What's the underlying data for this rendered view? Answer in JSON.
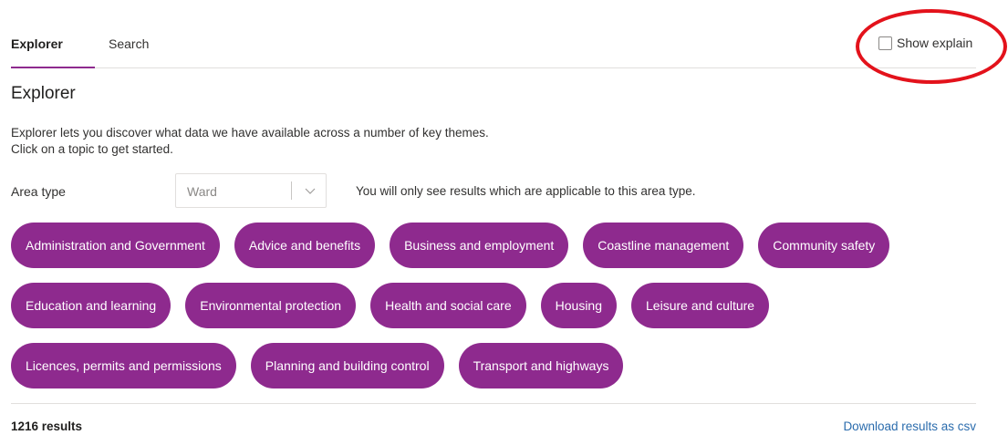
{
  "tabs": [
    {
      "label": "Explorer",
      "active": true
    },
    {
      "label": "Search",
      "active": false
    }
  ],
  "show_explain": {
    "label": "Show explain",
    "checked": false
  },
  "page_title": "Explorer",
  "intro": {
    "line1": "Explorer lets you discover what data we have available across a number of key themes.",
    "line2": "Click on a topic to get started."
  },
  "area_type": {
    "label": "Area type",
    "value": "Ward",
    "hint": "You will only see results which are applicable to this area type."
  },
  "topics": [
    "Administration and Government",
    "Advice and benefits",
    "Business and employment",
    "Coastline management",
    "Community safety",
    "Education and learning",
    "Environmental protection",
    "Health and social care",
    "Housing",
    "Leisure and culture",
    "Licences, permits and permissions",
    "Planning and building control",
    "Transport and highways"
  ],
  "results": {
    "count_label": "1216 results",
    "download_label": "Download results as csv"
  },
  "colors": {
    "accent": "#8e2a8e",
    "link": "#2b6cad",
    "annotation": "#e3121b"
  },
  "icons": {
    "dropdown": "chevron-down-icon",
    "checkbox": "checkbox-icon"
  }
}
